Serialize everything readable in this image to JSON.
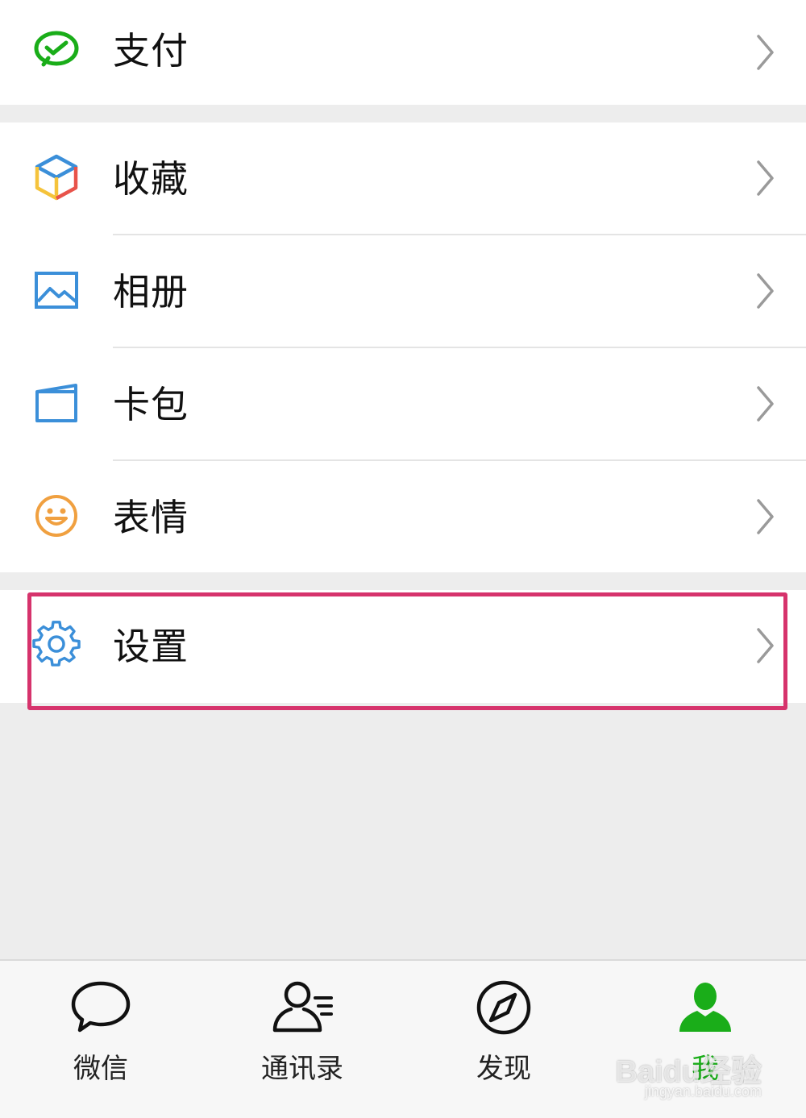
{
  "menu": {
    "pay": {
      "label": "支付",
      "icon": "wechat-pay-icon"
    },
    "favorites": {
      "label": "收藏",
      "icon": "cube-icon"
    },
    "album": {
      "label": "相册",
      "icon": "image-icon"
    },
    "cards": {
      "label": "卡包",
      "icon": "card-wallet-icon"
    },
    "stickers": {
      "label": "表情",
      "icon": "smiley-icon"
    },
    "settings": {
      "label": "设置",
      "icon": "gear-icon"
    }
  },
  "tabbar": {
    "tabs": [
      {
        "label": "微信",
        "icon": "chat-bubble-icon",
        "active": false
      },
      {
        "label": "通讯录",
        "icon": "contacts-icon",
        "active": false
      },
      {
        "label": "发现",
        "icon": "compass-icon",
        "active": false
      },
      {
        "label": "我",
        "icon": "person-icon",
        "active": true
      }
    ]
  },
  "watermark": {
    "text": "Baidu经验",
    "subtext": "jingyan.baidu.com"
  },
  "colors": {
    "accent_green": "#1aad19",
    "highlight": "#d6336c",
    "icon_blue": "#3b8fd9",
    "icon_orange": "#f0a040"
  }
}
